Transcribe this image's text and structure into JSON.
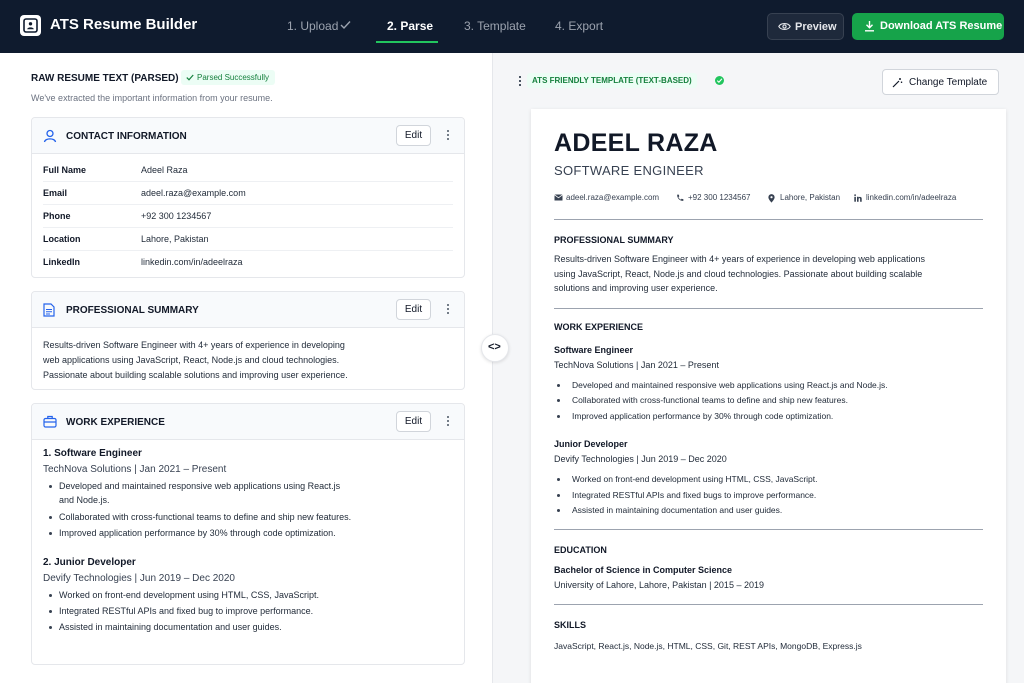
{
  "header": {
    "app_title": "ATS Resume Builder",
    "steps": [
      {
        "label": "1. Upload",
        "state": "done"
      },
      {
        "label": "2. Parse",
        "state": "active"
      },
      {
        "label": "3. Template",
        "state": "pending"
      },
      {
        "label": "4. Export",
        "state": "pending"
      }
    ],
    "preview_label": "Preview",
    "download_label": "Download ATS Resume"
  },
  "left": {
    "title": "RAW RESUME TEXT (PARSED)",
    "status_badge": "Parsed Successfully",
    "subtitle": "We've extracted the important information from your resume.",
    "edit_label": "Edit",
    "contact": {
      "title": "CONTACT INFORMATION",
      "rows": [
        {
          "key": "Full Name",
          "value": "Adeel Raza"
        },
        {
          "key": "Email",
          "value": "adeel.raza@example.com"
        },
        {
          "key": "Phone",
          "value": "+92 300 1234567"
        },
        {
          "key": "Location",
          "value": "Lahore, Pakistan"
        },
        {
          "key": "LinkedIn",
          "value": "linkedin.com/in/adeelraza"
        }
      ]
    },
    "summary": {
      "title": "PROFESSIONAL SUMMARY",
      "lines": [
        "Results-driven Software Engineer with 4+ years of experience in developing",
        "web applications using JavaScript, React, Node.js and cloud technologies.",
        "Passionate about building scalable solutions and improving user experience."
      ]
    },
    "work": {
      "title": "WORK EXPERIENCE",
      "jobs": [
        {
          "title": "1. Software Engineer",
          "company": "TechNova Solutions | Jan 2021 – Present",
          "bullets": [
            "Developed and maintained responsive web applications using React.js",
            "and Node.js.",
            "Collaborated with cross-functional teams to define and ship new features.",
            "Improved application performance by 30% through code optimization."
          ]
        },
        {
          "title": "2. Junior Developer",
          "company": "Devify Technologies | Jun 2019 – Dec 2020",
          "bullets": [
            "Worked on front-end development using HTML, CSS, JavaScript.",
            "Integrated RESTful APIs and fixed bug to improve performance.",
            "Assisted in maintaining documentation and user guides."
          ]
        }
      ]
    }
  },
  "right": {
    "template_badge": "ATS FRIENDLY TEMPLATE (TEXT-BASED)",
    "change_template_label": "Change Template",
    "resume": {
      "name": "ADEEL RAZA",
      "role": "SOFTWARE ENGINEER",
      "contact": {
        "email": "adeel.raza@example.com",
        "phone": "+92 300 1234567",
        "location": "Lahore, Pakistan",
        "linkedin": "linkedin.com/in/adeelraza"
      },
      "summary_title": "PROFESSIONAL SUMMARY",
      "summary_lines": [
        "Results-driven Software Engineer with 4+ years of experience in developing web applications",
        "using JavaScript, React, Node.js and cloud technologies. Passionate about building scalable",
        "solutions and improving user experience."
      ],
      "work_title": "WORK EXPERIENCE",
      "jobs": [
        {
          "title": "Software Engineer",
          "company": "TechNova Solutions | Jan 2021 – Present",
          "bullets": [
            "Developed and maintained responsive web applications using React.js and Node.js.",
            "Collaborated with cross-functional teams to define and ship new features.",
            "Improved application performance by 30% through code optimization."
          ]
        },
        {
          "title": "Junior Developer",
          "company": "Devify Technologies | Jun 2019 – Dec 2020",
          "bullets": [
            "Worked on front-end development using HTML, CSS, JavaScript.",
            "Integrated RESTful APIs and fixed bugs to improve performance.",
            "Assisted in maintaining documentation and user guides."
          ]
        }
      ],
      "education_title": "EDUCATION",
      "degree": "Bachelor of Science in Computer Science",
      "school": "University of Lahore, Lahore, Pakistan  |  2015 – 2019",
      "skills_title": "SKILLS",
      "skills": "JavaScript, React.js, Node.js, HTML, CSS, Git, REST APIs, MongoDB, Express.js"
    }
  },
  "colors": {
    "topbar": "#0f1b2e",
    "accent_green": "#16a34a",
    "icon_blue": "#2563eb"
  }
}
